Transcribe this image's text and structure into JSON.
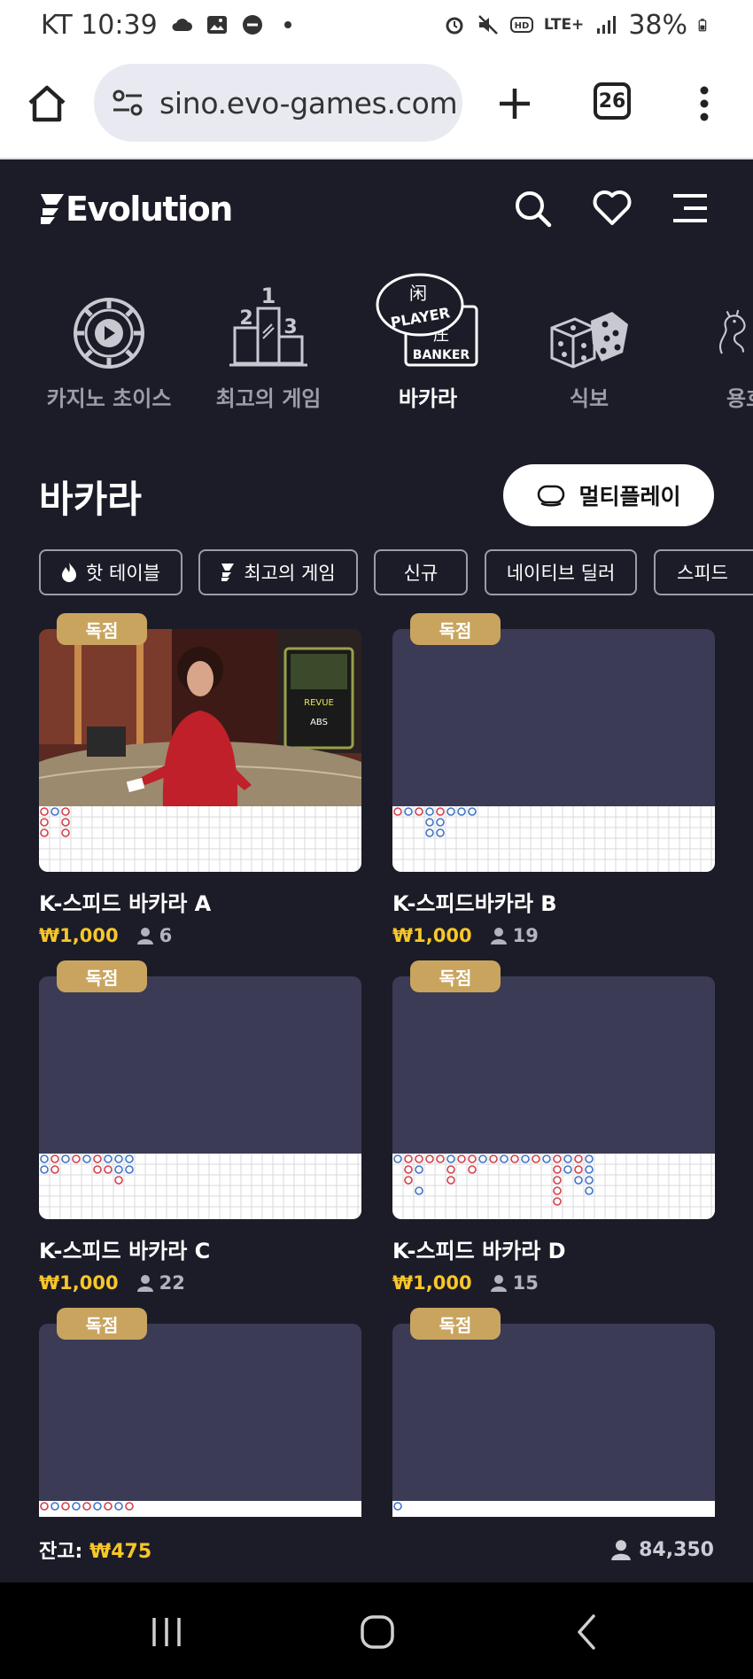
{
  "status_bar": {
    "carrier_time": "KT 10:39",
    "network": "LTE+",
    "battery": "38%"
  },
  "browser": {
    "url": "sino.evo-games.com",
    "tab_count": "26"
  },
  "header": {
    "logo_text": "Evolution"
  },
  "categories": [
    {
      "label": "카지노 초이스",
      "icon": "casino-chip-icon",
      "active": false
    },
    {
      "label": "최고의 게임",
      "icon": "podium-icon",
      "active": false
    },
    {
      "label": "바카라",
      "icon": "baccarat-icon",
      "active": true,
      "icon_text_top": "PLAYER",
      "icon_text_bottom": "BANKER"
    },
    {
      "label": "식보",
      "icon": "dice-icon",
      "active": false
    },
    {
      "label": "용호",
      "icon": "dragon-icon",
      "active": false
    }
  ],
  "section": {
    "title": "바카라",
    "multiplay_label": "멀티플레이"
  },
  "filters": [
    {
      "label": "핫 테이블",
      "icon": "flame-icon"
    },
    {
      "label": "최고의 게임",
      "icon": "evolution-mark-icon"
    },
    {
      "label": "신규",
      "icon": ""
    },
    {
      "label": "네이티브 딜러",
      "icon": ""
    },
    {
      "label": "스피드",
      "icon": ""
    }
  ],
  "tables": [
    {
      "badge": "독점",
      "title": "K-스피드 바카라 A",
      "min_bet": "₩1,000",
      "players": "6",
      "has_video": true
    },
    {
      "badge": "독점",
      "title": "K-스피드바카라 B",
      "min_bet": "₩1,000",
      "players": "19",
      "has_video": false
    },
    {
      "badge": "독점",
      "title": "K-스피드 바카라 C",
      "min_bet": "₩1,000",
      "players": "22",
      "has_video": false
    },
    {
      "badge": "독점",
      "title": "K-스피드 바카라 D",
      "min_bet": "₩1,000",
      "players": "15",
      "has_video": false
    },
    {
      "badge": "독점",
      "title": "",
      "min_bet": "",
      "players": "",
      "has_video": false
    },
    {
      "badge": "독점",
      "title": "",
      "min_bet": "",
      "players": "",
      "has_video": false
    }
  ],
  "video_overlay": {
    "screen_text_1": "REVUE",
    "screen_text_2": "ABS"
  },
  "footer": {
    "balance_label": "잔고:",
    "balance_value": "₩475",
    "online_count": "84,350"
  },
  "colors": {
    "background": "#1c1c28",
    "card": "#3b3b55",
    "badge": "#c9a45f",
    "price": "#f7c629",
    "player_blue": "#3f74c9",
    "banker_red": "#d2404a"
  }
}
